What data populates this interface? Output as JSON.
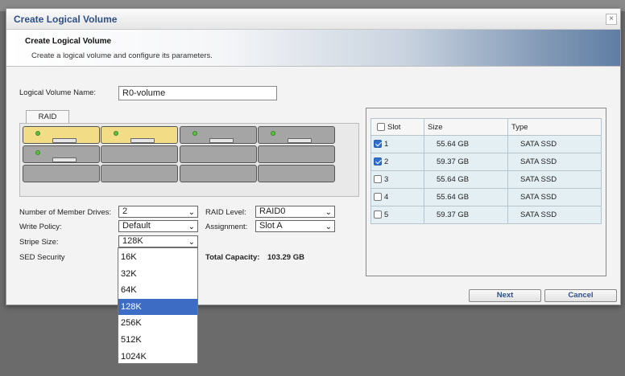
{
  "dialog": {
    "title": "Create Logical Volume",
    "close_glyph": "×",
    "header_title": "Create Logical Volume",
    "header_subtitle": "Create a logical volume and configure its parameters."
  },
  "form": {
    "volume_name_label": "Logical Volume Name:",
    "volume_name_value": "R0-volume",
    "tab_label": "RAID",
    "member_drives_label": "Number of Member Drives:",
    "member_drives_value": "2",
    "write_policy_label": "Write Policy:",
    "write_policy_value": "Default",
    "stripe_size_label": "Stripe Size:",
    "stripe_size_value": "128K",
    "sed_label": "SED Security",
    "raid_level_label": "RAID Level:",
    "raid_level_value": "RAID0",
    "assignment_label": "Assignment:",
    "assignment_value": "Slot A",
    "capacity_label": "Total Capacity:",
    "capacity_value": "103.29 GB",
    "chevron": "⌄"
  },
  "raid_bays": {
    "active": [
      true,
      true,
      false,
      false,
      false,
      false,
      false,
      false,
      false,
      false,
      false,
      false
    ],
    "led": [
      true,
      true,
      true,
      true,
      true,
      false,
      false,
      false,
      false,
      false,
      false,
      false
    ]
  },
  "slots": {
    "headers": {
      "slot": "Slot",
      "size": "Size",
      "type": "Type"
    },
    "rows": [
      {
        "slot": "1",
        "size": "55.64 GB",
        "type": "SATA SSD",
        "checked": true
      },
      {
        "slot": "2",
        "size": "59.37 GB",
        "type": "SATA SSD",
        "checked": true
      },
      {
        "slot": "3",
        "size": "55.64 GB",
        "type": "SATA SSD",
        "checked": false
      },
      {
        "slot": "4",
        "size": "55.64 GB",
        "type": "SATA SSD",
        "checked": false
      },
      {
        "slot": "5",
        "size": "59.37 GB",
        "type": "SATA SSD",
        "checked": false
      }
    ]
  },
  "buttons": {
    "next": "Next",
    "cancel": "Cancel"
  },
  "stripe_dropdown": {
    "options": [
      "16K",
      "32K",
      "64K",
      "128K",
      "256K",
      "512K",
      "1024K"
    ],
    "selected_index": 3
  },
  "colors": {
    "accent": "#2d4f8a",
    "selected": "#3d6cc4",
    "bay_active": "#f2dc86"
  }
}
